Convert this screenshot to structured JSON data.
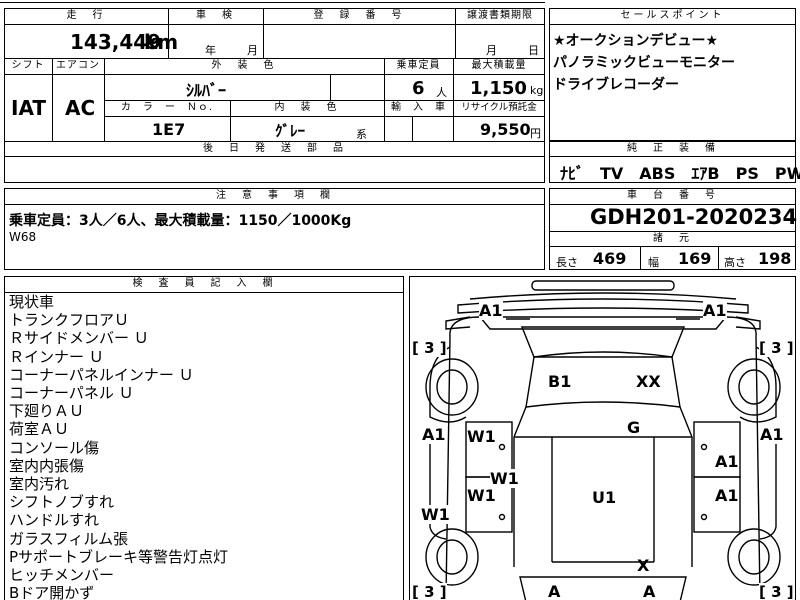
{
  "top_table": {
    "mileage_label": "走　行",
    "inspection_label": "車　検",
    "registration_label": "登　録　番　号",
    "transfer_label": "譲渡書類期限",
    "mileage_value": "143,449",
    "mileage_unit": "km",
    "inspection_year": "年",
    "inspection_month": "月",
    "transfer_month": "月",
    "transfer_day": "日",
    "shift_label": "シフト",
    "aircon_label": "エアコン",
    "exterior_color_label": "外　装　色",
    "capacity_label": "乗車定員",
    "max_load_label": "最大積載量",
    "shift_value": "IAT",
    "aircon_value": "AC",
    "exterior_color_value": "ｼﾙﾊﾞｰ",
    "capacity_value": "6",
    "capacity_unit": "人",
    "max_load_value": "1,150",
    "max_load_unit": "kg",
    "color_no_label": "カ　ラ　ー　Ｎｏ.",
    "interior_color_label": "内　装　色",
    "import_label": "輸　入　車",
    "recycle_label": "リサイクル預託金",
    "color_no_value": "1E7",
    "interior_color_value": "ｸﾞﾚｰ",
    "interior_color_suffix": "系",
    "recycle_value": "9,550",
    "recycle_unit": "円",
    "later_parts_label": "後　日　発　送　部　品"
  },
  "sales_points": {
    "label": "セールスポイント",
    "lines": [
      "★オークションデビュー★",
      "パノラミックビューモニター",
      "ドライブレコーダー"
    ]
  },
  "equipment": {
    "label": "純　正　装　備",
    "value": "ﾅﾋﾞ　TV　ABS　ｴｱB　PS　PW"
  },
  "notes": {
    "label": "注　意　事　項　欄",
    "line1": "乗車定員：3人／6人、最大積載量：1150／1000Kg",
    "line2": "W68"
  },
  "chassis": {
    "label": "車　台　番　号",
    "value": "GDH201-2020234"
  },
  "dimensions": {
    "label": "諸　元",
    "length_label": "長さ",
    "length_value": "469",
    "width_label": "幅",
    "width_value": "169",
    "height_label": "高さ",
    "height_value": "198"
  },
  "inspector": {
    "label": "検　査　員　記　入　欄",
    "lines": [
      "現状車",
      "トランクフロアＵ",
      "Ｒサイドメンバー Ｕ",
      "Ｒインナー Ｕ",
      "コーナーパネルインナー Ｕ",
      "コーナーパネル Ｕ",
      "下廻りＡＵ",
      "荷室ＡＵ",
      "コンソール傷",
      "室内内張傷",
      "室内汚れ",
      "シフトノブすれ",
      "ハンドルすれ",
      "ガラスフィルム張",
      "Pサポートブレーキ等警告灯点灯",
      "ヒッチメンバー",
      "Bドア開かず"
    ]
  },
  "diagram": {
    "marks": {
      "a1_front_left": "A1",
      "a1_front_right": "A1",
      "b1": "B1",
      "xx": "XX",
      "g": "G",
      "a1_left": "A1",
      "a1_right": "A1",
      "w1_left_upper": "W1",
      "w1_center": "W1",
      "w1_left_lower": "W1",
      "w1_far_left": "W1",
      "a1_right_upper": "A1",
      "a1_right_lower": "A1",
      "u1": "U1",
      "x": "X",
      "a_rear_left": "A",
      "a_rear_right": "A"
    },
    "tire_marks": {
      "front_left": "[ 3 ]",
      "front_right": "[ 3 ]",
      "rear_left": "[ 3 ]",
      "rear_right": "[ 3 ]"
    }
  }
}
